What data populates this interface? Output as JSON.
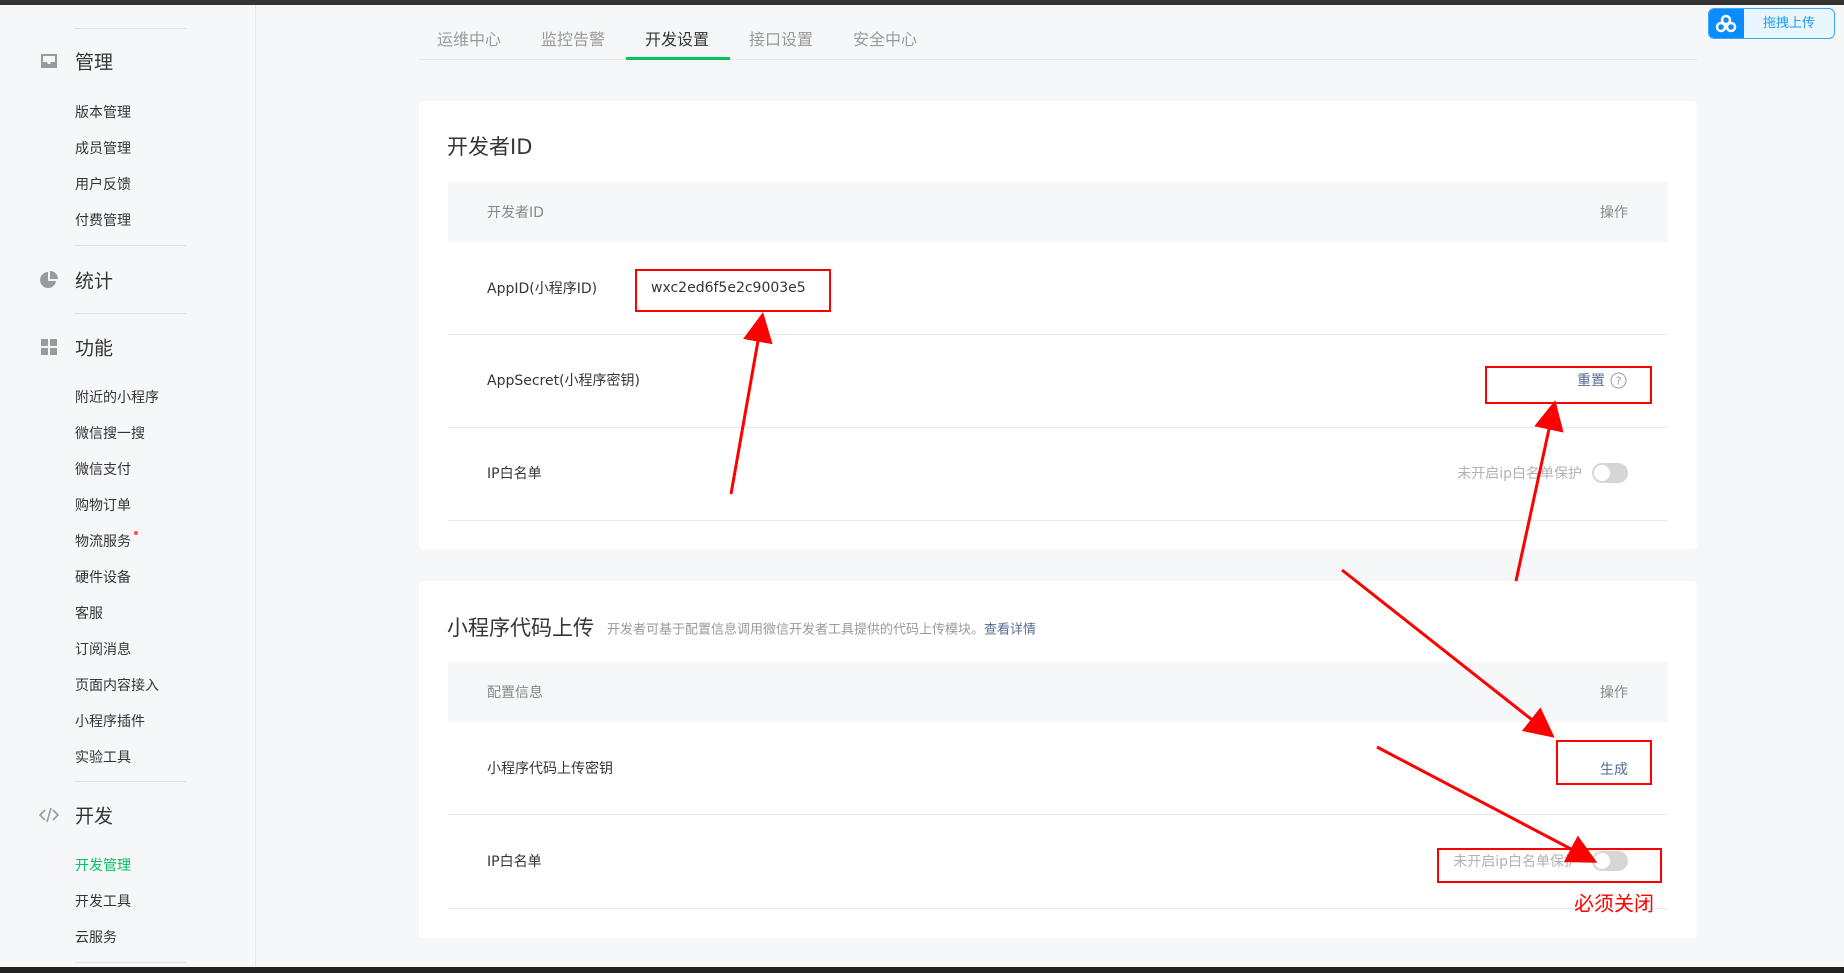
{
  "sidebar": {
    "sections": [
      {
        "title": "管理",
        "items": [
          "版本管理",
          "成员管理",
          "用户反馈",
          "付费管理"
        ]
      },
      {
        "title": "统计",
        "items": []
      },
      {
        "title": "功能",
        "items": [
          "附近的小程序",
          "微信搜一搜",
          "微信支付",
          "购物订单",
          "物流服务",
          "硬件设备",
          "客服",
          "订阅消息",
          "页面内容接入",
          "小程序插件",
          "实验工具"
        ]
      },
      {
        "title": "开发",
        "items": [
          "开发管理",
          "开发工具",
          "云服务"
        ]
      }
    ]
  },
  "tabs": [
    "运维中心",
    "监控告警",
    "开发设置",
    "接口设置",
    "安全中心"
  ],
  "active_tab": "开发设置",
  "upload_button": "拖拽上传",
  "dev_id_card": {
    "title": "开发者ID",
    "header": {
      "col1": "开发者ID",
      "col2": "操作"
    },
    "rows": [
      {
        "label": "AppID(小程序ID)",
        "value": "wxc2ed6f5e2c9003e5"
      },
      {
        "label": "AppSecret(小程序密钥)",
        "action": "重置"
      },
      {
        "label": "IP白名单",
        "status": "未开启ip白名单保护"
      }
    ]
  },
  "upload_card": {
    "title": "小程序代码上传",
    "desc": "开发者可基于配置信息调用微信开发者工具提供的代码上传模块。",
    "link": "查看详情",
    "header": {
      "col1": "配置信息",
      "col2": "操作"
    },
    "rows": [
      {
        "label": "小程序代码上传密钥",
        "action": "生成"
      },
      {
        "label": "IP白名单",
        "status": "未开启ip白名单保护"
      }
    ]
  },
  "annotation": "必须关闭",
  "colors": {
    "accent": "#07c160",
    "link": "#576b95",
    "annotation": "#ff0000"
  }
}
